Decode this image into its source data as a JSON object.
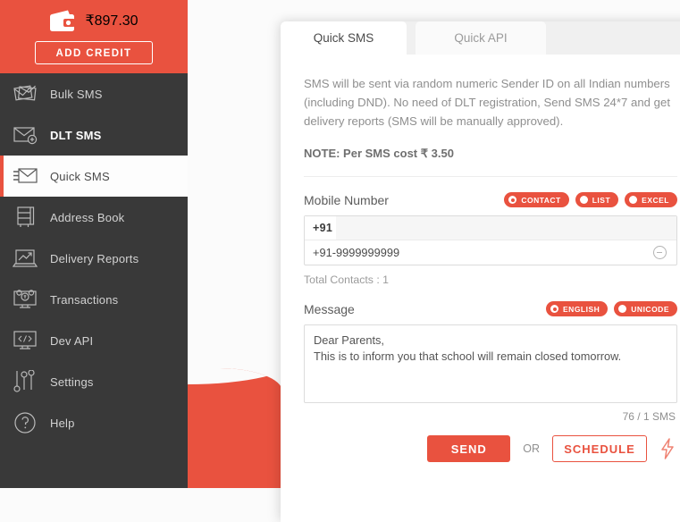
{
  "sidebar": {
    "wallet": {
      "icon": "wallet-icon",
      "balance": "₹897.30",
      "add_credit_label": "ADD CREDIT"
    },
    "items": [
      {
        "label": "Bulk SMS",
        "icon": "envelopes-icon",
        "active": false,
        "bold": false
      },
      {
        "label": "DLT SMS",
        "icon": "envelope-plus-icon",
        "active": false,
        "bold": true
      },
      {
        "label": "Quick SMS",
        "icon": "envelope-fast-icon",
        "active": true,
        "bold": false
      },
      {
        "label": "Address Book",
        "icon": "address-book-icon",
        "active": false,
        "bold": false
      },
      {
        "label": "Delivery Reports",
        "icon": "laptop-chart-icon",
        "active": false,
        "bold": false
      },
      {
        "label": "Transactions",
        "icon": "monitor-coins-icon",
        "active": false,
        "bold": false
      },
      {
        "label": "Dev API",
        "icon": "monitor-code-icon",
        "active": false,
        "bold": false
      },
      {
        "label": "Settings",
        "icon": "sliders-icon",
        "active": false,
        "bold": false
      },
      {
        "label": "Help",
        "icon": "question-circle-icon",
        "active": false,
        "bold": false
      }
    ]
  },
  "card": {
    "tabs": [
      {
        "label": "Quick SMS",
        "selected": true
      },
      {
        "label": "Quick API",
        "selected": false
      }
    ],
    "intro_text": "SMS will be sent via random numeric Sender ID on all Indian numbers (including DND). No need of DLT registration, Send SMS 24*7 and get delivery reports (SMS will be manually approved).",
    "note_text": "NOTE: Per SMS cost ₹ 3.50",
    "mobile_number": {
      "title": "Mobile Number",
      "source_options": [
        {
          "label": "CONTACT",
          "selected": true
        },
        {
          "label": "LIST",
          "selected": false
        },
        {
          "label": "EXCEL",
          "selected": false
        }
      ],
      "country_prefix": "+91",
      "input_value": "",
      "input_placeholder": "",
      "entries": [
        {
          "value": "+91-9999999999",
          "remove_icon": "minus-circle-icon"
        }
      ],
      "total_contacts_label": "Total Contacts : 1"
    },
    "message": {
      "title": "Message",
      "encoding_options": [
        {
          "label": "ENGLISH",
          "selected": true
        },
        {
          "label": "UNICODE",
          "selected": false
        }
      ],
      "value": "Dear Parents,\nThis is to inform you that school will remain closed tomorrow.",
      "placeholder": "",
      "counter": "76 / 1 SMS"
    },
    "actions": {
      "send_label": "SEND",
      "or_label": "OR",
      "schedule_label": "SCHEDULE",
      "bolt_icon": "lightning-bolt-icon"
    }
  },
  "colors": {
    "accent": "#e9523f",
    "sidebar_bg": "#393939",
    "page_bg": "#fbfbfb",
    "card_bg": "#ffffff",
    "muted_text": "#8f8f8f"
  }
}
